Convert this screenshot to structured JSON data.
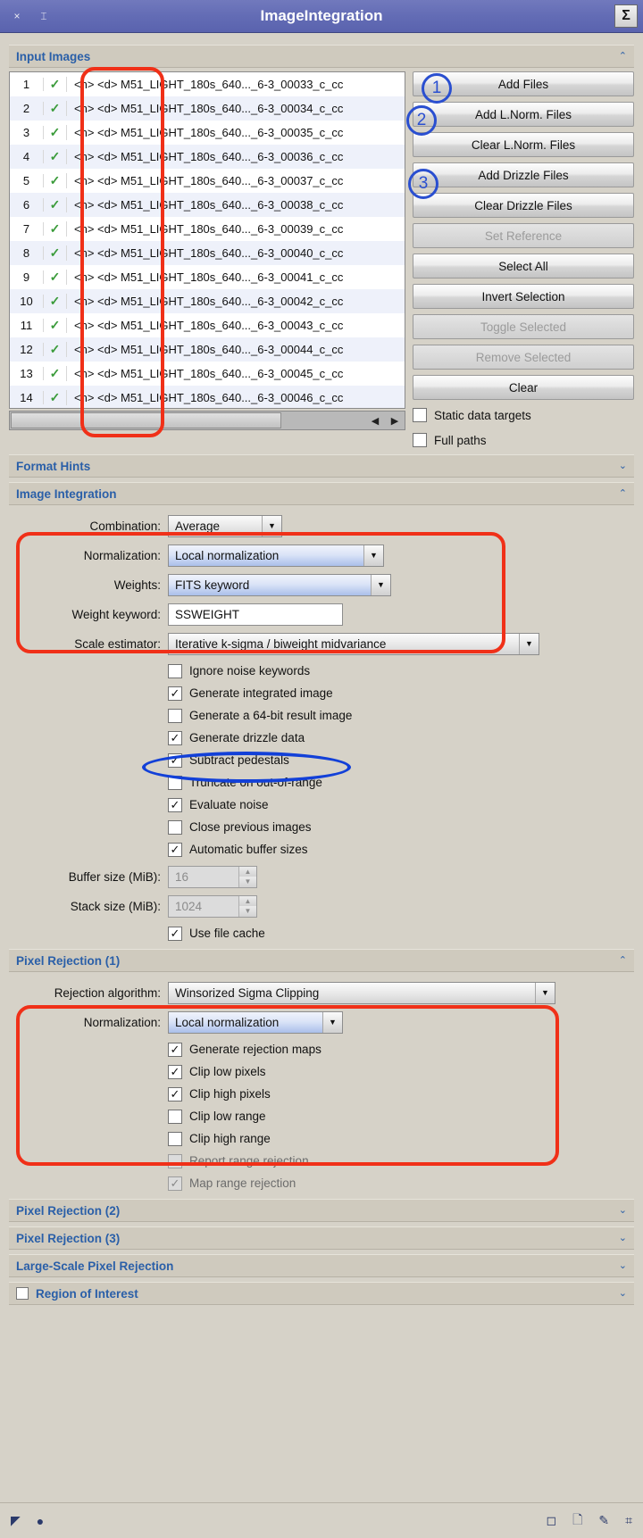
{
  "window": {
    "title": "ImageIntegration",
    "close_icon": "×",
    "collapse_icon": "⌶",
    "sigma_icon": "Σ"
  },
  "sections": {
    "input_images": {
      "title": "Input Images",
      "arrow": "⌃"
    },
    "format_hints": {
      "title": "Format Hints",
      "arrow": "⌄"
    },
    "image_integration": {
      "title": "Image Integration",
      "arrow": "⌃"
    },
    "pixel_rejection_1": {
      "title": "Pixel Rejection (1)",
      "arrow": "⌃"
    },
    "pixel_rejection_2": {
      "title": "Pixel Rejection (2)",
      "arrow": "⌄"
    },
    "pixel_rejection_3": {
      "title": "Pixel Rejection (3)",
      "arrow": "⌄"
    },
    "large_scale_pixel_rejection": {
      "title": "Large-Scale Pixel Rejection",
      "arrow": "⌄"
    },
    "region_of_interest": {
      "title": "Region of Interest",
      "arrow": "⌄"
    }
  },
  "file_list": {
    "check_glyph": "✓",
    "prefix": "<n> <d>",
    "rows": [
      {
        "index": "1",
        "name": "<n> <d> M51_LIGHT_180s_640..._6-3_00033_c_cc"
      },
      {
        "index": "2",
        "name": "<n> <d> M51_LIGHT_180s_640..._6-3_00034_c_cc"
      },
      {
        "index": "3",
        "name": "<n> <d> M51_LIGHT_180s_640..._6-3_00035_c_cc"
      },
      {
        "index": "4",
        "name": "<n> <d> M51_LIGHT_180s_640..._6-3_00036_c_cc"
      },
      {
        "index": "5",
        "name": "<n> <d> M51_LIGHT_180s_640..._6-3_00037_c_cc"
      },
      {
        "index": "6",
        "name": "<n> <d> M51_LIGHT_180s_640..._6-3_00038_c_cc"
      },
      {
        "index": "7",
        "name": "<n> <d> M51_LIGHT_180s_640..._6-3_00039_c_cc"
      },
      {
        "index": "8",
        "name": "<n> <d> M51_LIGHT_180s_640..._6-3_00040_c_cc"
      },
      {
        "index": "9",
        "name": "<n> <d> M51_LIGHT_180s_640..._6-3_00041_c_cc"
      },
      {
        "index": "10",
        "name": "<n> <d> M51_LIGHT_180s_640..._6-3_00042_c_cc"
      },
      {
        "index": "11",
        "name": "<n> <d> M51_LIGHT_180s_640..._6-3_00043_c_cc"
      },
      {
        "index": "12",
        "name": "<n> <d> M51_LIGHT_180s_640..._6-3_00044_c_cc"
      },
      {
        "index": "13",
        "name": "<n> <d> M51_LIGHT_180s_640..._6-3_00045_c_cc"
      },
      {
        "index": "14",
        "name": "<n> <d> M51_LIGHT_180s_640..._6-3_00046_c_cc"
      }
    ],
    "scroll_left_icon": "◀",
    "scroll_right_icon": "▶"
  },
  "input_buttons": [
    {
      "label": "Add Files",
      "enabled": true,
      "badge": "1"
    },
    {
      "label": "Add L.Norm. Files",
      "enabled": true,
      "badge": "2"
    },
    {
      "label": "Clear L.Norm. Files",
      "enabled": true,
      "badge": ""
    },
    {
      "label": "Add Drizzle Files",
      "enabled": true,
      "badge": "3"
    },
    {
      "label": "Clear Drizzle Files",
      "enabled": true,
      "badge": ""
    },
    {
      "label": "Set Reference",
      "enabled": false,
      "badge": ""
    },
    {
      "label": "Select All",
      "enabled": true,
      "badge": ""
    },
    {
      "label": "Invert Selection",
      "enabled": true,
      "badge": ""
    },
    {
      "label": "Toggle Selected",
      "enabled": false,
      "badge": ""
    },
    {
      "label": "Remove Selected",
      "enabled": false,
      "badge": ""
    },
    {
      "label": "Clear",
      "enabled": true,
      "badge": ""
    }
  ],
  "input_checks": [
    {
      "label": "Static data targets",
      "checked": false
    },
    {
      "label": "Full paths",
      "checked": false
    }
  ],
  "image_integration": {
    "combination_label": "Combination:",
    "combination_value": "Average",
    "normalization_label": "Normalization:",
    "normalization_value": "Local normalization",
    "weights_label": "Weights:",
    "weights_value": "FITS keyword",
    "weight_keyword_label": "Weight keyword:",
    "weight_keyword_value": "SSWEIGHT",
    "scale_estimator_label": "Scale estimator:",
    "scale_estimator_value": "Iterative k-sigma / biweight midvariance",
    "checkboxes": [
      {
        "label": "Ignore noise keywords",
        "checked": false,
        "enabled": true
      },
      {
        "label": "Generate integrated image",
        "checked": true,
        "enabled": true
      },
      {
        "label": "Generate a 64-bit result image",
        "checked": false,
        "enabled": true
      },
      {
        "label": "Generate drizzle data",
        "checked": true,
        "enabled": true
      },
      {
        "label": "Subtract pedestals",
        "checked": true,
        "enabled": true
      },
      {
        "label": "Truncate on out-of-range",
        "checked": false,
        "enabled": true
      },
      {
        "label": "Evaluate noise",
        "checked": true,
        "enabled": true
      },
      {
        "label": "Close previous images",
        "checked": false,
        "enabled": true
      },
      {
        "label": "Automatic buffer sizes",
        "checked": true,
        "enabled": true
      }
    ],
    "buffer_size_label": "Buffer size (MiB):",
    "buffer_size_value": "16",
    "stack_size_label": "Stack size (MiB):",
    "stack_size_value": "1024",
    "use_file_cache": {
      "label": "Use file cache",
      "checked": true
    }
  },
  "pixel_rejection_1": {
    "algorithm_label": "Rejection algorithm:",
    "algorithm_value": "Winsorized Sigma Clipping",
    "normalization_label": "Normalization:",
    "normalization_value": "Local normalization",
    "checkboxes": [
      {
        "label": "Generate rejection maps",
        "checked": true,
        "enabled": true
      },
      {
        "label": "Clip low pixels",
        "checked": true,
        "enabled": true
      },
      {
        "label": "Clip high pixels",
        "checked": true,
        "enabled": true
      },
      {
        "label": "Clip low range",
        "checked": false,
        "enabled": true
      },
      {
        "label": "Clip high range",
        "checked": false,
        "enabled": true
      },
      {
        "label": "Report range rejection",
        "checked": false,
        "enabled": false
      },
      {
        "label": "Map range rejection",
        "checked": true,
        "enabled": false
      }
    ]
  },
  "statusbar": {
    "cursor_icon": "◤",
    "dot_icon": "●",
    "new_instance_icon": "◻",
    "doc_icon": "🗋",
    "wrench_icon": "✎",
    "reset_icon": "⌗"
  },
  "colors": {
    "titlebar": "#636cb5",
    "section_title": "#2a5fa8",
    "annotation_red": "#f03018",
    "annotation_blue": "#1240d8",
    "check_green": "#3a9b3a",
    "panel_bg": "#d6d2c8"
  }
}
